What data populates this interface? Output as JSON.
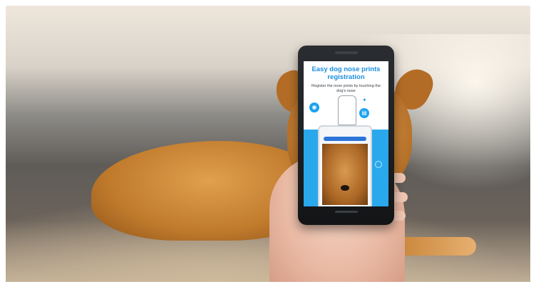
{
  "image": {
    "scene": "photo",
    "app_screen": {
      "title": "Easy dog nose prints registration",
      "subtitle": "Register the nose prints by touching the dog's nose",
      "icons": [
        "camera-icon",
        "document-icon",
        "sparkle-icon"
      ],
      "accent_color": "#1aa3ef"
    }
  }
}
